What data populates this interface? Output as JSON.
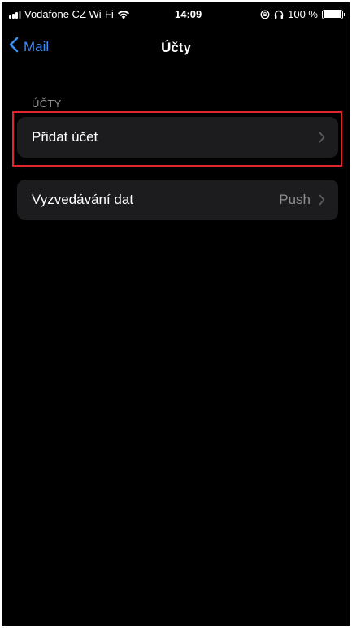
{
  "status_bar": {
    "carrier": "Vodafone CZ Wi-Fi",
    "time": "14:09",
    "battery": "100 %",
    "battery_level": 1.0
  },
  "nav": {
    "back_label": "Mail",
    "title": "Účty"
  },
  "accounts_section": {
    "header": "ÚČTY",
    "add_account_label": "Přidat účet"
  },
  "fetch_section": {
    "label": "Vyzvedávání dat",
    "value": "Push"
  },
  "colors": {
    "background": "#000000",
    "cell_background": "#1c1c1e",
    "accent": "#3a8ef6",
    "secondary_text": "#8e8e93",
    "highlight": "#e0262c"
  },
  "icons": {
    "signal": "signal-bars-icon",
    "wifi": "wifi-icon",
    "rotation_lock": "rotation-lock-icon",
    "headphones": "headphones-icon",
    "battery": "battery-icon",
    "back": "chevron-left-icon",
    "disclosure": "chevron-right-icon"
  }
}
